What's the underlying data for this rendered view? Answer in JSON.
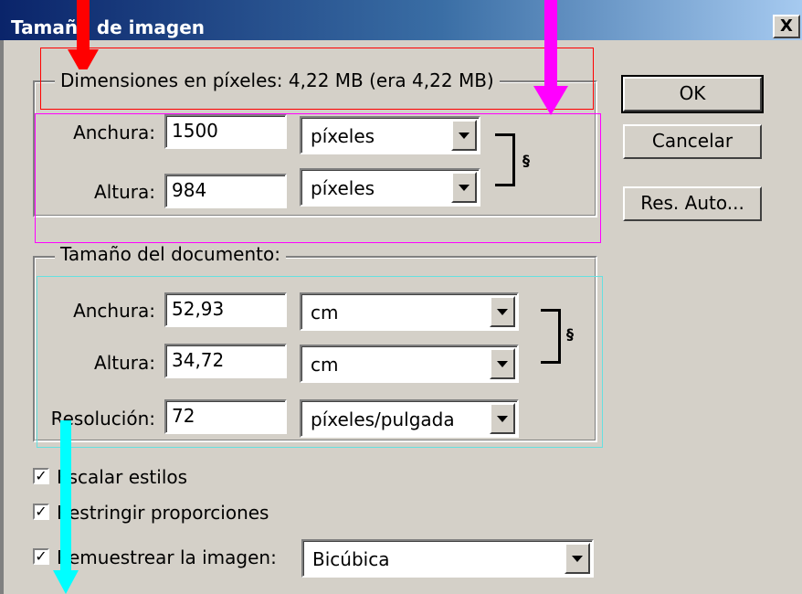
{
  "window": {
    "title": "Tamaño de imagen",
    "close_label": "X"
  },
  "pixel_dimensions": {
    "legend": "Dimensiones en píxeles: 4,22 MB (era 4,22 MB)",
    "width_label": "Anchura:",
    "width_value": "1500",
    "width_unit": "píxeles",
    "height_label": "Altura:",
    "height_value": "984",
    "height_unit": "píxeles"
  },
  "document_size": {
    "legend": "Tamaño del documento:",
    "width_label": "Anchura:",
    "width_value": "52,93",
    "width_unit": "cm",
    "height_label": "Altura:",
    "height_value": "34,72",
    "height_unit": "cm",
    "resolution_label": "Resolución:",
    "resolution_value": "72",
    "resolution_unit": "píxeles/pulgada"
  },
  "options": {
    "scale_styles_label": "Escalar estilos",
    "scale_styles_checked": true,
    "constrain_label": "Restringir proporciones",
    "constrain_checked": true,
    "resample_label": "Remuestrear la imagen:",
    "resample_checked": true,
    "resample_method": "Bicúbica"
  },
  "buttons": {
    "ok": "OK",
    "cancel": "Cancelar",
    "auto": "Res. Auto..."
  },
  "annotation_colors": {
    "red": "#ff0000",
    "magenta": "#ff00ff",
    "cyan": "#00ffff"
  }
}
